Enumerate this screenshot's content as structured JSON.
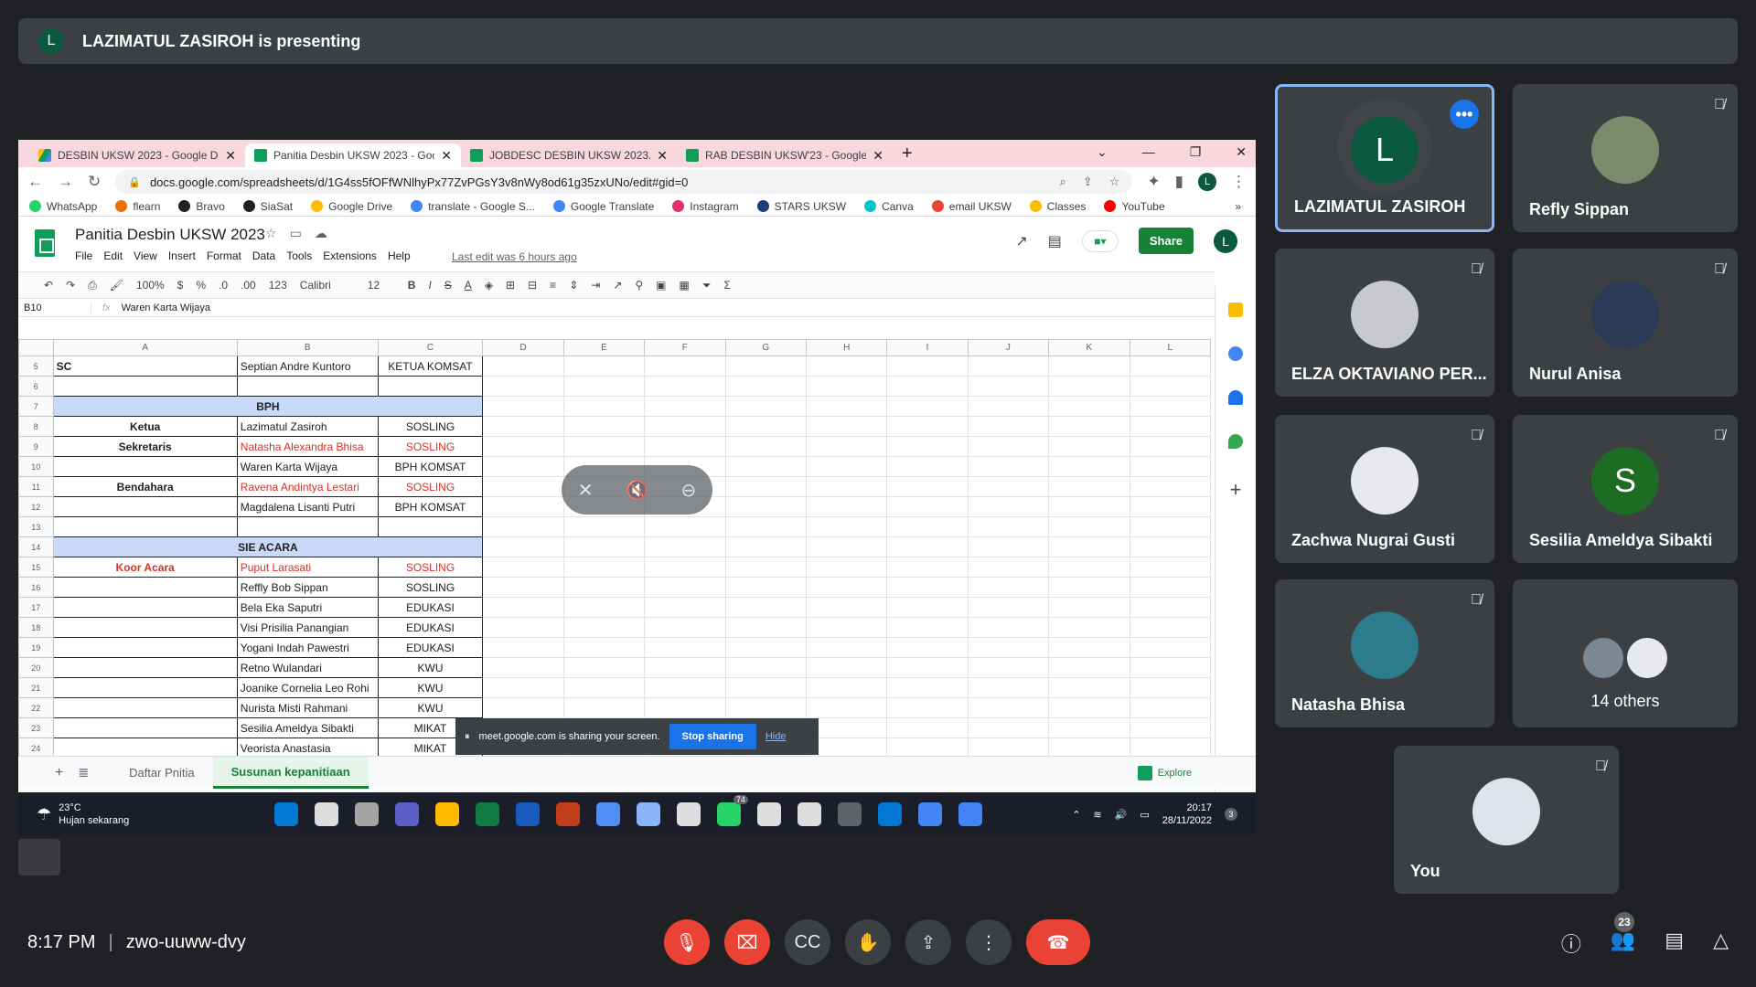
{
  "banner": {
    "initial": "L",
    "text": "LAZIMATUL ZASIROH is presenting"
  },
  "browser": {
    "tabs": [
      {
        "label": "DESBIN UKSW 2023 - Google Dr",
        "icon": "drive"
      },
      {
        "label": "Panitia Desbin UKSW 2023 - Goo",
        "icon": "sheets",
        "active": true
      },
      {
        "label": "JOBDESC DESBIN UKSW 2023.xls",
        "icon": "sheets"
      },
      {
        "label": "RAB DESBIN UKSW'23 - Google S",
        "icon": "sheets"
      }
    ],
    "new_tab": "+",
    "url": "docs.google.com/spreadsheets/d/1G4ss5fOFfWNlhyPx77ZvPGsY3v8nWy8od61g35zxUNo/edit#gid=0",
    "profile_initial": "L",
    "bookmarks": [
      "WhatsApp",
      "flearn",
      "Bravo",
      "SiaSat",
      "Google Drive",
      "translate - Google S...",
      "Google Translate",
      "Instagram",
      "STARS UKSW",
      "Canva",
      "email UKSW",
      "Classes",
      "YouTube"
    ],
    "bookmark_colors": [
      "#25d366",
      "#e8710a",
      "#202124",
      "#202124",
      "#fbbc04",
      "#4285f4",
      "#4285f4",
      "#e1306c",
      "#1a3d7c",
      "#00c4cc",
      "#ea4335",
      "#fbbc04",
      "#ff0000"
    ]
  },
  "sheet": {
    "title": "Panitia Desbin UKSW 2023",
    "menu": [
      "File",
      "Edit",
      "View",
      "Insert",
      "Format",
      "Data",
      "Tools",
      "Extensions",
      "Help"
    ],
    "last_edit": "Last edit was 6 hours ago",
    "share": "Share",
    "toolbar": {
      "zoom": "100%",
      "currency": "$",
      "percent": "%",
      "dec_down": ".0",
      "dec_up": ".00",
      "fmt": "123",
      "font": "Calibri",
      "size": "12"
    },
    "namebox": "B10",
    "formula": "Waren Karta Wijaya",
    "cols": [
      "A",
      "B",
      "C",
      "D",
      "E",
      "F",
      "G",
      "H",
      "I",
      "J",
      "K",
      "L"
    ],
    "rows": [
      {
        "n": "5",
        "a": "SC",
        "b": "Septian Andre Kuntoro",
        "c": "KETUA KOMSAT"
      },
      {
        "n": "6",
        "a": "",
        "b": "",
        "c": ""
      },
      {
        "n": "7",
        "band": "BPH"
      },
      {
        "n": "8",
        "a": "Ketua",
        "b": "Lazimatul Zasiroh",
        "c": "SOSLING"
      },
      {
        "n": "9",
        "a": "Sekretaris",
        "b": "Natasha Alexandra Bhisa",
        "c": "SOSLING",
        "red": true
      },
      {
        "n": "10",
        "a": "",
        "b": "Waren Karta Wijaya",
        "c": "BPH KOMSAT"
      },
      {
        "n": "11",
        "a": "Bendahara",
        "b": "Ravena Andintya Lestari",
        "c": "SOSLING",
        "red": true
      },
      {
        "n": "12",
        "a": "",
        "b": "Magdalena Lisanti Putri",
        "c": "BPH KOMSAT"
      },
      {
        "n": "13",
        "a": "",
        "b": "",
        "c": ""
      },
      {
        "n": "14",
        "band": "SIE ACARA"
      },
      {
        "n": "15",
        "a": "Koor Acara",
        "b": "Puput Larasati",
        "c": "SOSLING",
        "red": true,
        "reda": true
      },
      {
        "n": "16",
        "a": "",
        "b": "Reffly Bob Sippan",
        "c": "SOSLING"
      },
      {
        "n": "17",
        "a": "",
        "b": "Bela Eka Saputri",
        "c": "EDUKASI"
      },
      {
        "n": "18",
        "a": "",
        "b": "Visi Prisilia Panangian",
        "c": "EDUKASI"
      },
      {
        "n": "19",
        "a": "",
        "b": "Yogani Indah Pawestri",
        "c": "EDUKASI"
      },
      {
        "n": "20",
        "a": "",
        "b": "Retno Wulandari",
        "c": "KWU"
      },
      {
        "n": "21",
        "a": "",
        "b": "Joanike Cornelia Leo Rohi",
        "c": "KWU"
      },
      {
        "n": "22",
        "a": "",
        "b": "Nurista Misti Rahmani",
        "c": "KWU"
      },
      {
        "n": "23",
        "a": "",
        "b": "Sesilia Ameldya Sibakti",
        "c": "MIKAT"
      },
      {
        "n": "24",
        "a": "",
        "b": "Veorista Anastasia",
        "c": "MIKAT"
      }
    ],
    "sheet_tabs": [
      "Daftar Pnitia",
      "Susunan kepanitiaan"
    ],
    "explore": "Explore"
  },
  "share_notice": {
    "text": "meet.google.com is sharing your screen.",
    "stop": "Stop sharing",
    "hide": "Hide"
  },
  "taskbar": {
    "temp": "23°C",
    "weather": "Hujan sekarang",
    "time": "20:17",
    "date": "28/11/2022",
    "badge": "74",
    "notif": "3",
    "app_colors": [
      "#0078d4",
      "#ffffff",
      "#a4a4a4",
      "#5b5fc7",
      "#ffb900",
      "#107c41",
      "#185abd",
      "#c43e1c",
      "#4f8ef7",
      "#8ab4f8",
      "#ffffff",
      "#25d366",
      "#ffffff",
      "#ffffff",
      "#5f6368",
      "#0078d4",
      "#4285f4",
      "#4285f4"
    ]
  },
  "participants": [
    {
      "name": "LAZIMATUL ZASIROH",
      "initial": "L",
      "color": "#0b5a3f",
      "speaking": true
    },
    {
      "name": "Refly Sippan",
      "color": "#7a8a6a"
    },
    {
      "name": "ELZA OKTAVIANO PER...",
      "color": "#c7c9cc"
    },
    {
      "name": "Nurul Anisa",
      "color": "#2b3a55"
    },
    {
      "name": "Zachwa Nugrai Gusti",
      "color": "#e7e9ee"
    },
    {
      "name": "Sesilia Ameldya Sibakti",
      "initial": "S",
      "color": "#1e6b24"
    },
    {
      "name": "Natasha Bhisa",
      "color": "#2d7c8c"
    },
    {
      "name": "14 others",
      "others": true
    },
    {
      "name": "You",
      "color": "#dfe4ea"
    }
  ],
  "meeting": {
    "time": "8:17 PM",
    "code": "zwo-uuww-dvy",
    "participant_count": "23"
  }
}
